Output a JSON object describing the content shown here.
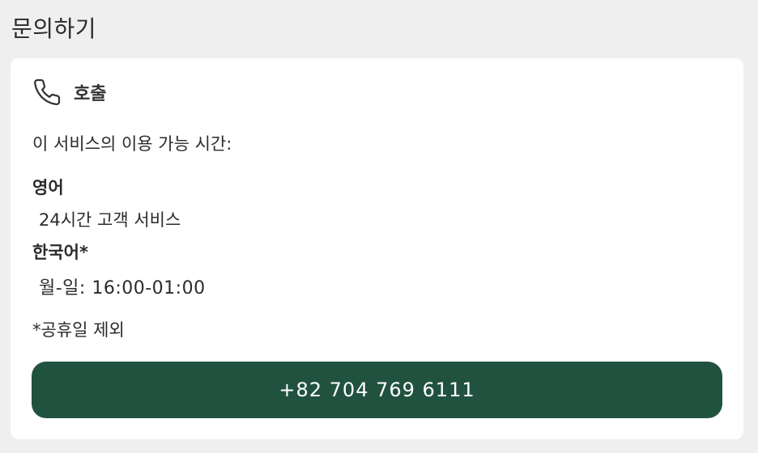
{
  "page": {
    "title": "문의하기"
  },
  "call_card": {
    "icon": "phone-icon",
    "title": "호출",
    "intro": "이 서비스의 이용 가능 시간:",
    "languages": [
      {
        "name": "영어",
        "hours": "24시간 고객 서비스"
      },
      {
        "name": "한국어*",
        "hours": "월-일: 16:00-01:00"
      }
    ],
    "note": "*공휴일 제외",
    "phone_button_label": "+82 704 769 6111"
  },
  "colors": {
    "background": "#efefef",
    "card": "#ffffff",
    "button": "#215240",
    "button_text": "#ffffff"
  }
}
